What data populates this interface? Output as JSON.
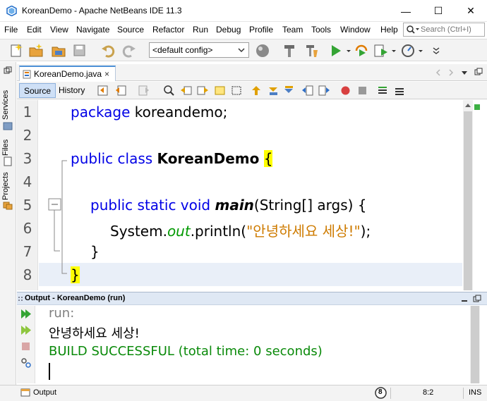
{
  "window": {
    "title": "KoreanDemo - Apache NetBeans IDE 11.3",
    "minimize": "—",
    "maximize": "☐",
    "close": "✕"
  },
  "menu": [
    "File",
    "Edit",
    "View",
    "Navigate",
    "Source",
    "Refactor",
    "Run",
    "Debug",
    "Profile",
    "Team",
    "Tools",
    "Window",
    "Help"
  ],
  "search": {
    "placeholder": "Search (Ctrl+I)"
  },
  "toolbar": {
    "config": "<default config>"
  },
  "sidebar": {
    "tabs": [
      "Services",
      "Files",
      "Projects"
    ]
  },
  "editor": {
    "tab_label": "KoreanDemo.java",
    "tab_close": "×",
    "source_label": "Source",
    "history_label": "History",
    "lines": [
      {
        "no": "1"
      },
      {
        "no": "2"
      },
      {
        "no": "3"
      },
      {
        "no": "4"
      },
      {
        "no": "5"
      },
      {
        "no": "6"
      },
      {
        "no": "7"
      },
      {
        "no": "8"
      }
    ],
    "code": {
      "l1_kw": "package",
      "l1_rest": " koreandemo;",
      "l3_kw": "public class ",
      "l3_cls": "KoreanDemo",
      "l3_sp": " ",
      "l3_brace": "{",
      "l5_kw": "public static void ",
      "l5_main": "main",
      "l5_rest": "(String[] args) {",
      "l6_sys": "System.",
      "l6_out": "out",
      "l6_call": ".println(",
      "l6_str": "\"안녕하세요 세상!\"",
      "l6_end": ");",
      "l7_brace": "}",
      "l8_brace": "}"
    }
  },
  "output": {
    "title": "Output - KoreanDemo (run)",
    "run": "run:",
    "message": "안녕하세요 세상!",
    "build": "BUILD SUCCESSFUL (total time: 0 seconds)"
  },
  "status": {
    "output_label": "Output",
    "badge": "8",
    "position": "8:2",
    "mode": "INS"
  }
}
